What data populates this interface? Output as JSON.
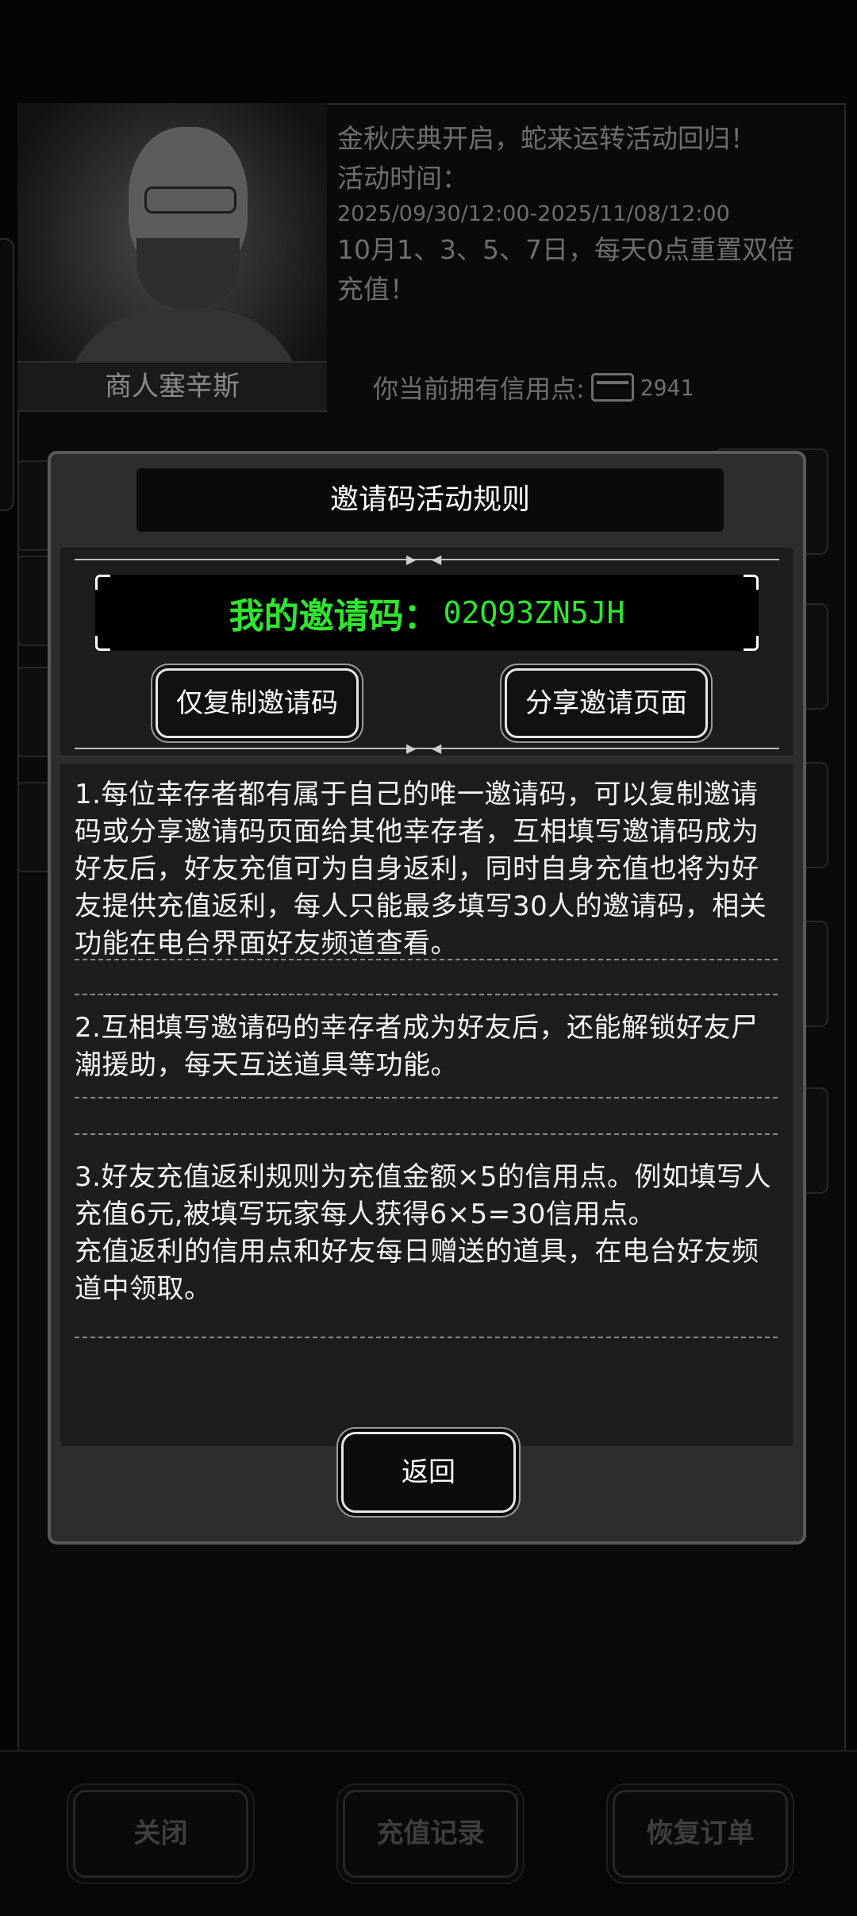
{
  "background": {
    "merchant_name": "商人塞辛斯",
    "announcement": {
      "line1": "金秋庆典开启，蛇来运转活动回归！",
      "line2": "活动时间：",
      "date_range": "2025/09/30/12:00-2025/11/08/12:00",
      "line3": "10月1、3、5、7日，每天0点重置双倍",
      "line4": "充值！"
    },
    "credit_label": "你当前拥有信用点:",
    "credit_icon": "credit-card-icon",
    "credit_value": "2941",
    "bottom_buttons": {
      "close": "关闭",
      "recharge_record": "充值记录",
      "restore_order": "恢复订单"
    }
  },
  "modal": {
    "title": "邀请码活动规则",
    "invite_label": "我的邀请码：",
    "invite_code": "02Q93ZN5JH",
    "copy_button": "仅复制邀请码",
    "share_button": "分享邀请页面",
    "rules": [
      "1.每位幸存者都有属于自己的唯一邀请码，可以复制邀请码或分享邀请码页面给其他幸存者，互相填写邀请码成为好友后，好友充值可为自身返利，同时自身充值也将为好友提供充值返利，每人只能最多填写30人的邀请码，相关功能在电台界面好友频道查看。",
      "2.互相填写邀请码的幸存者成为好友后，还能解锁好友尸潮援助，每天互送道具等功能。",
      "3.好友充值返利规则为充值金额×5的信用点。例如填写人充值6元,被填写玩家每人获得6×5=30信用点。",
      "充值返利的信用点和好友每日赠送的道具，在电台好友频道中领取。"
    ],
    "back_button": "返回"
  },
  "colors": {
    "invite_code_green": "#2fe62f",
    "modal_bg": "#2d2d2d",
    "panel_bg": "#1d1d1d"
  }
}
